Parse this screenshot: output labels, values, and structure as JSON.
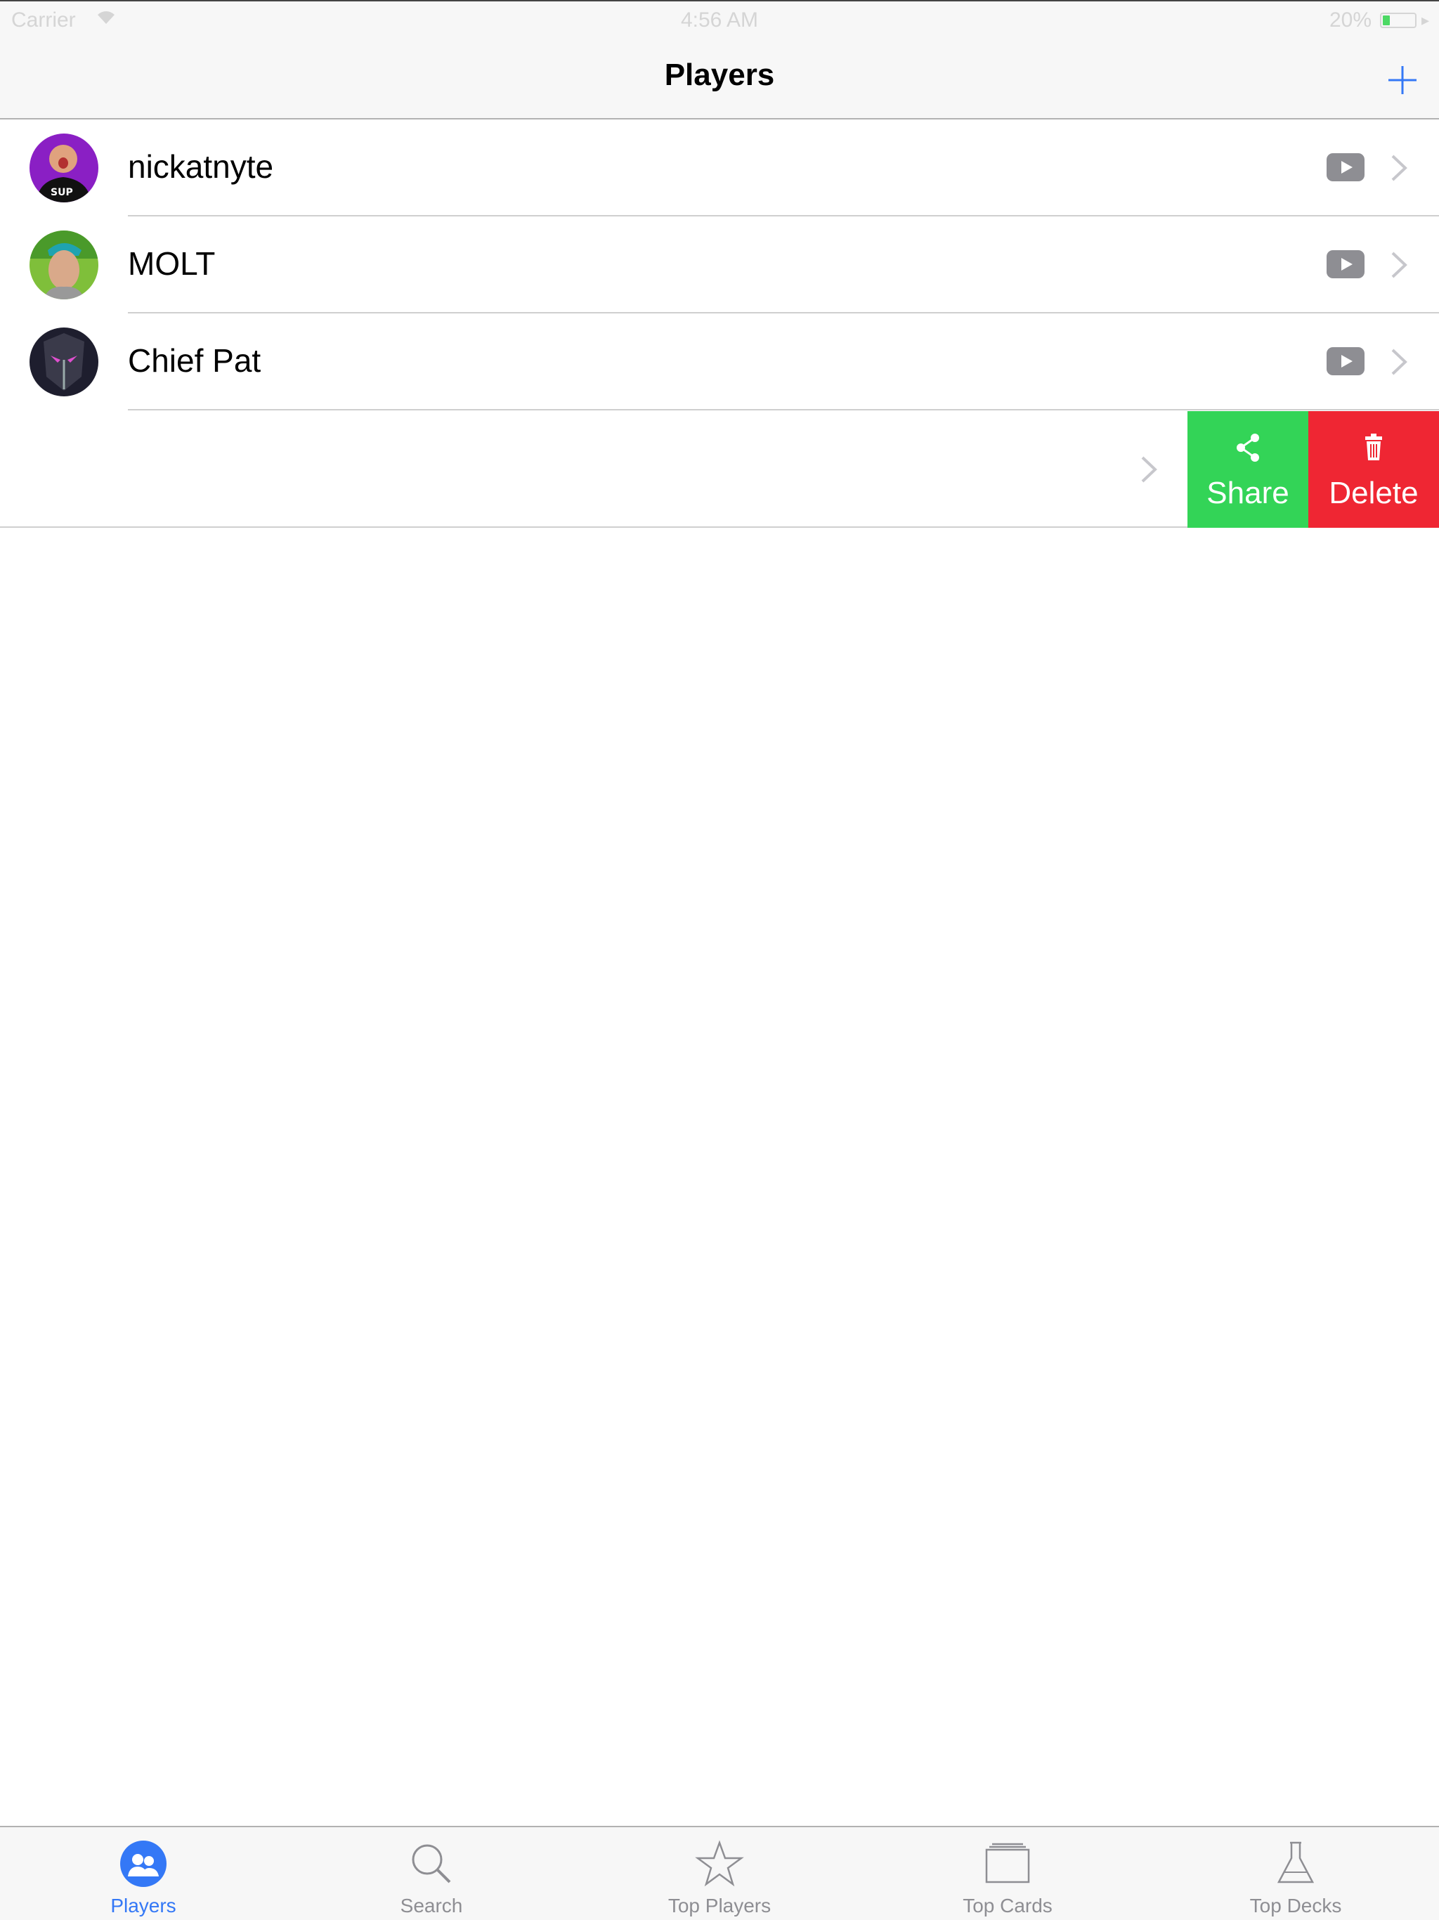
{
  "status_bar": {
    "carrier": "Carrier",
    "time": "4:56 AM",
    "battery": "20%"
  },
  "nav": {
    "title": "Players",
    "add_icon": "plus-icon"
  },
  "players": [
    {
      "name": "nickatnyte",
      "avatar_color": "#8a1fc4"
    },
    {
      "name": "MOLT",
      "avatar_color": "#7fbf3a"
    },
    {
      "name": "Chief Pat",
      "avatar_color": "#2a2a3a"
    }
  ],
  "swipe_actions": {
    "share": "Share",
    "delete": "Delete"
  },
  "tabs": [
    {
      "label": "Players",
      "icon": "players-icon",
      "active": true
    },
    {
      "label": "Search",
      "icon": "search-icon",
      "active": false
    },
    {
      "label": "Top Players",
      "icon": "star-icon",
      "active": false
    },
    {
      "label": "Top Cards",
      "icon": "cards-icon",
      "active": false
    },
    {
      "label": "Top Decks",
      "icon": "flask-icon",
      "active": false
    }
  ],
  "colors": {
    "accent": "#3478f6",
    "share": "#33d457",
    "delete": "#ef2633",
    "youtube": "#8e8e93"
  }
}
